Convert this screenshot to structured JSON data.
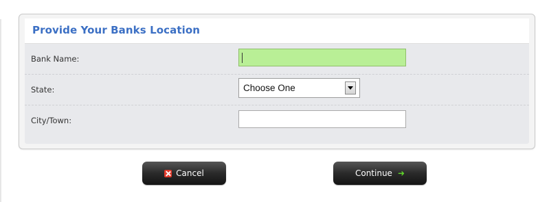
{
  "panel": {
    "title": "Provide Your Banks Location"
  },
  "fields": {
    "bank_name": {
      "label": "Bank Name:",
      "value": ""
    },
    "state": {
      "label": "State:",
      "selected": "Choose One"
    },
    "city_town": {
      "label": "City/Town:",
      "value": ""
    }
  },
  "buttons": {
    "cancel": "Cancel",
    "continue": "Continue"
  },
  "icons": {
    "cancel": "close-icon",
    "continue": "arrow-right-icon",
    "select": "chevron-down-icon"
  },
  "colors": {
    "title": "#3b6fc4",
    "active_field": "#b9ef96",
    "button": "#222222",
    "cancel_icon": "#e23a2b",
    "continue_icon": "#5fd32a"
  }
}
